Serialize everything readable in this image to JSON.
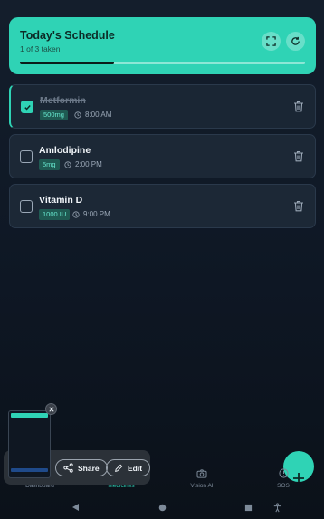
{
  "header": {
    "title": "Today's Schedule",
    "subtitle": "1 of 3 taken",
    "progress": 0.33,
    "expand_icon": "expand-icon",
    "refresh_icon": "refresh-icon"
  },
  "medicines": [
    {
      "name": "Metformin",
      "dose": "500mg",
      "time": "8:00 AM",
      "taken": true
    },
    {
      "name": "Amlodipine",
      "dose": "5mg",
      "time": "2:00 PM",
      "taken": false
    },
    {
      "name": "Vitamin D",
      "dose": "1000 IU",
      "time": "9:00 PM",
      "taken": false
    }
  ],
  "nav": {
    "items": [
      {
        "label": "Dashboard",
        "icon": "dashboard-icon",
        "active": false
      },
      {
        "label": "Medicines",
        "icon": "pill-icon",
        "active": true
      },
      {
        "label": "Vision AI",
        "icon": "camera-icon",
        "active": false
      },
      {
        "label": "SOS",
        "icon": "alert-icon",
        "active": false
      }
    ]
  },
  "overlay": {
    "share_label": "Share",
    "edit_label": "Edit"
  },
  "colors": {
    "accent": "#2fd3b5",
    "background": "#0e1724",
    "card": "#1c2836"
  }
}
